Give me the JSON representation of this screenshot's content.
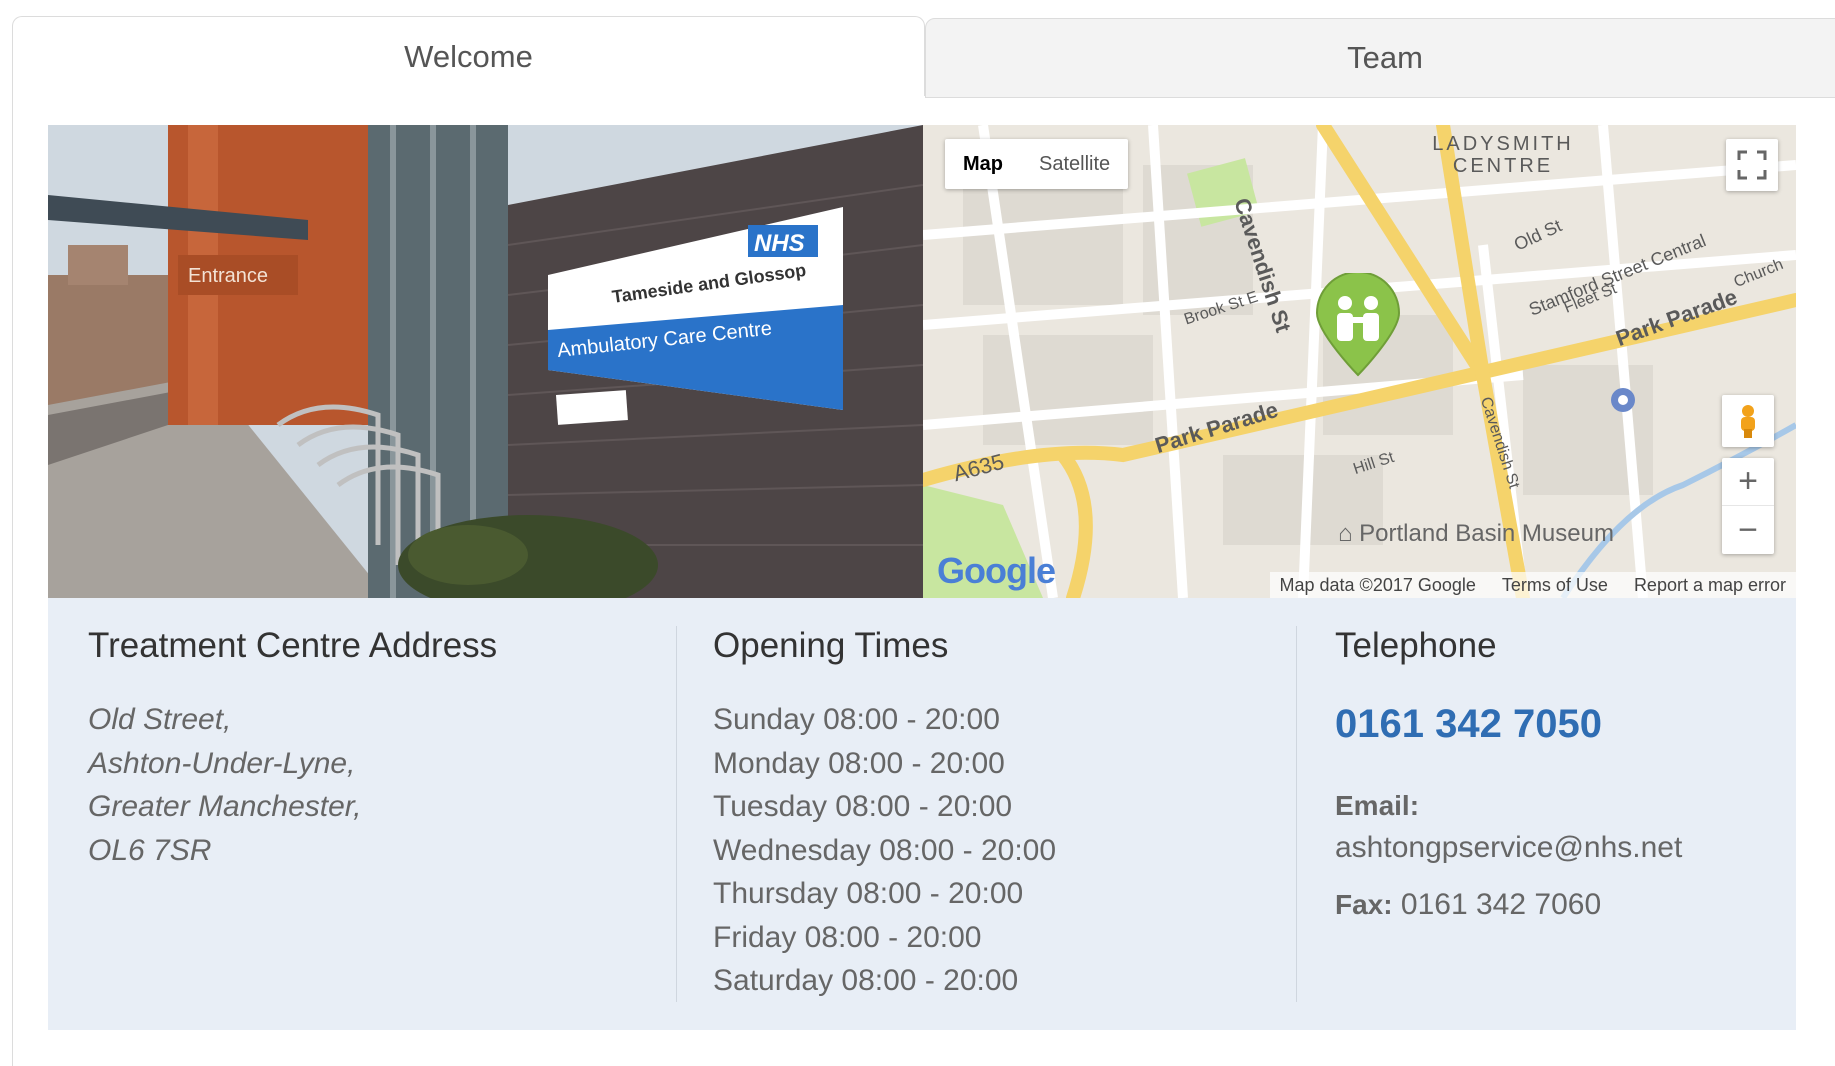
{
  "tabs": [
    {
      "label": "Welcome",
      "active": true
    },
    {
      "label": "Team",
      "active": false
    }
  ],
  "photo": {
    "entrance_sign": "Entrance",
    "sign_logo": "NHS",
    "sign_line1": "Tameside and Glossop",
    "sign_line2": "Ambulatory Care Centre"
  },
  "map": {
    "type_map": "Map",
    "type_satellite": "Satellite",
    "logo": "Google",
    "footer_data": "Map data ©2017 Google",
    "footer_terms": "Terms of Use",
    "footer_report": "Report a map error",
    "labels": {
      "ladysmith": "LADYSMITH CENTRE",
      "cavendish": "Cavendish St",
      "cavendish2": "Cavendish St",
      "park_parade": "Park Parade",
      "park_parade2": "Park Parade",
      "a635": "A635",
      "old_st": "Old St",
      "stamford": "Stamford Street Central",
      "fleet": "Fleet St",
      "church": "Church",
      "brook": "Brook St E",
      "hill": "Hill St",
      "portland": "Portland Basin Museum"
    },
    "zoom_in": "+",
    "zoom_out": "−",
    "colors": {
      "marker": "#8bc34a",
      "road": "#f5d36b",
      "water": "#a7c8e8",
      "park": "#c8e6a0"
    }
  },
  "address": {
    "heading": "Treatment Centre Address",
    "lines": [
      "Old Street,",
      "Ashton-Under-Lyne,",
      "Greater Manchester,",
      "OL6 7SR"
    ]
  },
  "opening": {
    "heading": "Opening Times",
    "days": [
      "Sunday 08:00 - 20:00",
      "Monday 08:00 - 20:00",
      "Tuesday 08:00 - 20:00",
      "Wednesday 08:00 - 20:00",
      "Thursday 08:00 - 20:00",
      "Friday 08:00 - 20:00",
      "Saturday 08:00 - 20:00"
    ]
  },
  "telephone": {
    "heading": "Telephone",
    "phone": "0161 342 7050",
    "email_label": "Email:",
    "email": "ashtongpservice@nhs.net",
    "fax_label": "Fax:",
    "fax": "0161 342 7060"
  }
}
